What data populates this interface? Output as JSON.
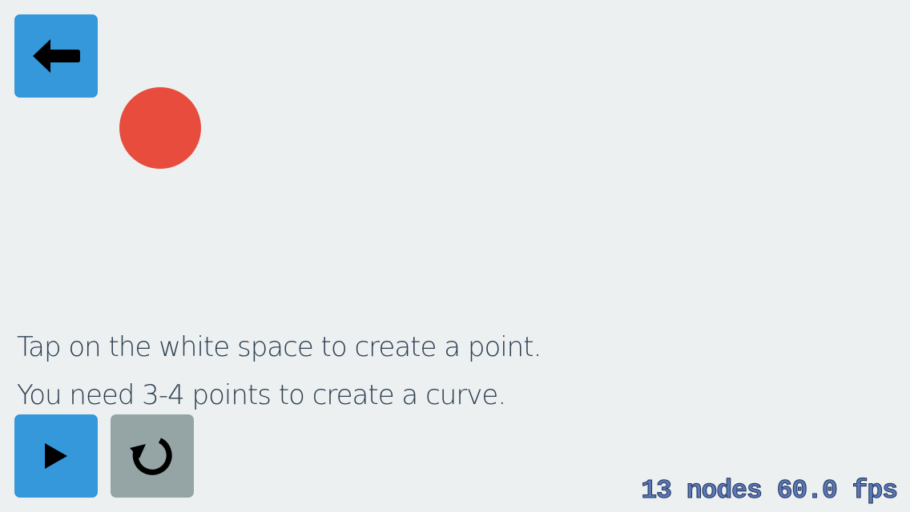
{
  "toolbar": {
    "back_icon": "arrow-left-icon",
    "play_icon": "play-icon",
    "reset_icon": "reload-icon"
  },
  "canvas": {
    "point_color": "#E74C3C"
  },
  "instructions": {
    "line1": "Tap on the white space to create a point.",
    "line2": "You need 3-4 points to create a curve."
  },
  "debug": {
    "stats": "13 nodes 60.0 fps"
  },
  "colors": {
    "background": "#ECF0F1",
    "button_primary": "#3498DB",
    "button_secondary": "#95A5A6"
  }
}
